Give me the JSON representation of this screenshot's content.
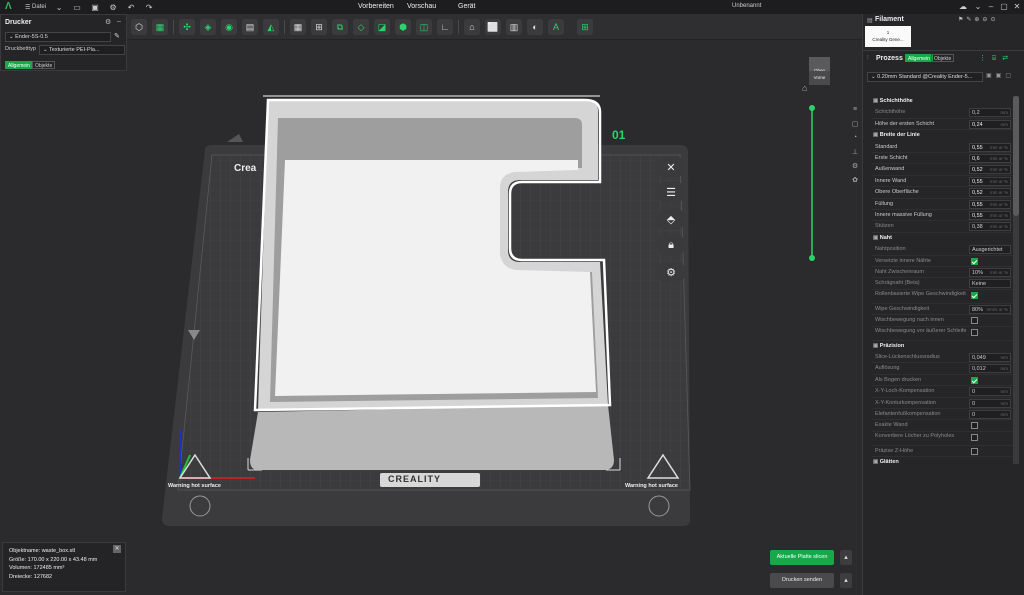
{
  "topbar": {
    "file_menu": "Datei",
    "tabs": [
      "Vorbereiten",
      "Vorschau",
      "Gerät"
    ],
    "title": "Unbenannt"
  },
  "printer_panel": {
    "title": "Drucker",
    "printer": "Ender-5S-0.5",
    "bed_label": "Druckbetttyp",
    "bed_value": "Texturierte PEI-Pla...",
    "tabs": [
      "Allgemein",
      "Objekte"
    ]
  },
  "viewport": {
    "plate_number": "01",
    "plate_name": "Crea",
    "brand": "CREALITY",
    "warning_left": "Warning hot surface",
    "warning_right": "Warning hot surface",
    "view_top": "Oben",
    "view_front": "Vorne"
  },
  "object_info": {
    "name": "Objektname: waste_box.stl",
    "size": "Größe: 170.00 x 220.00 x 43.48 mm",
    "volume": "Volumen: 172485 mm³",
    "triangles": "Dreiecke: 127682"
  },
  "actions": {
    "slice": "Aktuelle Platte slicen",
    "send": "Drucken senden"
  },
  "right_panel": {
    "filament_title": "Filament",
    "filament_slot": "1",
    "filament_name": "Creality Gene...",
    "process_title": "Prozess",
    "process_tabs": [
      "Allgemein",
      "Objekte"
    ],
    "process_profile": "0.20mm Standard @Creality Ender-5..."
  },
  "settings": [
    {
      "type": "head",
      "label": "Schichthöhe"
    },
    {
      "type": "value",
      "label": "Schichthöhe",
      "value": "0,2",
      "unit": "mm",
      "dim": true
    },
    {
      "type": "value",
      "label": "Höhe der ersten Schicht",
      "value": "0,24",
      "unit": "mm",
      "dim": false
    },
    {
      "type": "head",
      "label": "Breite der Linie"
    },
    {
      "type": "value",
      "label": "Standard",
      "value": "0,55",
      "unit": "mm or %",
      "dim": false
    },
    {
      "type": "value",
      "label": "Erste Schicht",
      "value": "0,6",
      "unit": "mm or %",
      "dim": false
    },
    {
      "type": "value",
      "label": "Außenwand",
      "value": "0,52",
      "unit": "mm or %",
      "dim": false
    },
    {
      "type": "value",
      "label": "Innere Wand",
      "value": "0,55",
      "unit": "mm or %",
      "dim": false
    },
    {
      "type": "value",
      "label": "Obere Oberfläche",
      "value": "0,52",
      "unit": "mm or %",
      "dim": false
    },
    {
      "type": "value",
      "label": "Füllung",
      "value": "0,55",
      "unit": "mm or %",
      "dim": false
    },
    {
      "type": "value",
      "label": "Innere massive Füllung",
      "value": "0,55",
      "unit": "mm or %",
      "dim": false
    },
    {
      "type": "value",
      "label": "Stützen",
      "value": "0,38",
      "unit": "mm or %",
      "dim": true
    },
    {
      "type": "head",
      "label": "Naht"
    },
    {
      "type": "value",
      "label": "Nahtposition",
      "value": "Ausgerichtet",
      "unit": "",
      "dim": true
    },
    {
      "type": "check",
      "label": "Versetzte innere Nähte",
      "checked": true,
      "dim": true
    },
    {
      "type": "value",
      "label": "Naht Zwischenraum",
      "value": "10%",
      "unit": "mm or %",
      "dim": true
    },
    {
      "type": "value",
      "label": "Schrägnaht (Beta)",
      "value": "Keine",
      "unit": "",
      "dim": true
    },
    {
      "type": "check",
      "label": "Rollenbasierte Wipe Geschwindigkeit",
      "checked": true,
      "dim": true
    },
    {
      "type": "value",
      "label": "Wipe Geschwindigkeit",
      "value": "80%",
      "unit": "mm/s or %",
      "dim": true
    },
    {
      "type": "check",
      "label": "Wischbewegung nach innen",
      "checked": false,
      "dim": true
    },
    {
      "type": "check",
      "label": "Wischbewegung vor äußerer Schleife",
      "checked": false,
      "dim": true
    },
    {
      "type": "head",
      "label": "Präzision"
    },
    {
      "type": "value",
      "label": "Slice-Lückenschlussradius",
      "value": "0,049",
      "unit": "mm",
      "dim": true
    },
    {
      "type": "value",
      "label": "Auflösung",
      "value": "0,012",
      "unit": "mm",
      "dim": true
    },
    {
      "type": "check",
      "label": "Als Bogen drucken",
      "checked": true,
      "dim": true
    },
    {
      "type": "value",
      "label": "X-Y-Loch-Kompensation",
      "value": "0",
      "unit": "mm",
      "dim": true
    },
    {
      "type": "value",
      "label": "X-Y-Konturkompensation",
      "value": "0",
      "unit": "mm",
      "dim": true
    },
    {
      "type": "value",
      "label": "Elefantenfußkompensation",
      "value": "0",
      "unit": "mm",
      "dim": true
    },
    {
      "type": "check",
      "label": "Exakte Wand",
      "checked": false,
      "dim": true
    },
    {
      "type": "check",
      "label": "Konvertiere Löcher zu Polyholes",
      "checked": false,
      "dim": true
    },
    {
      "type": "check",
      "label": "Präzise Z-Höhe",
      "checked": false,
      "dim": true
    },
    {
      "type": "head",
      "label": "Glätten"
    }
  ],
  "colors": {
    "accent": "#17a84a",
    "bed": "#3a3a3c",
    "model": "#e6e6e6"
  }
}
